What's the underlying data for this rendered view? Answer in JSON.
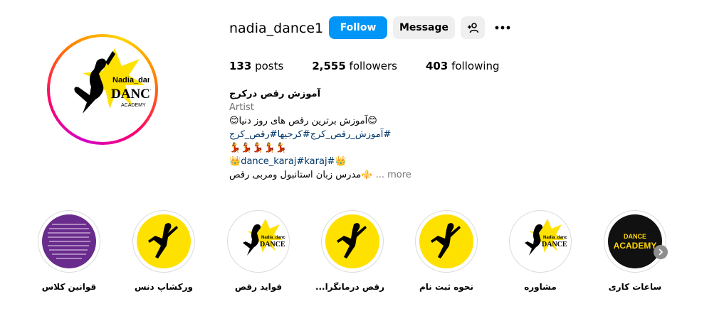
{
  "profile": {
    "username": "nadia_dance1",
    "follow_label": "Follow",
    "message_label": "Message",
    "logo_text": {
      "line1": "Nadia_dance",
      "line2": "DANCE",
      "line3": "ACADEMY"
    }
  },
  "stats": {
    "posts_count": "133",
    "posts_label": "posts",
    "followers_count": "2,555",
    "followers_label": "followers",
    "following_count": "403",
    "following_label": "following"
  },
  "bio": {
    "name": "آموزش رقص درکرج",
    "category": "Artist",
    "line1": "😊آموزش برترین رقص های روز دنیا😊",
    "line2": "#آموزش_رقص_کرج#کرجیها#رقص_کرج",
    "line3": "💃💃💃💃💃",
    "line4_prefix": "👑",
    "line4_link": "dance_karaj#karaj#",
    "line4_suffix": "👑",
    "line5_text": "⚜️مدرس زبان استانبول ومربی رقص",
    "line5_more": "... more"
  },
  "highlights": [
    {
      "label": "قوانین کلاس",
      "kind": "purple-text"
    },
    {
      "label": "ورکشاپ دنس",
      "kind": "yellow-dancer"
    },
    {
      "label": "فواید رقص",
      "kind": "logo"
    },
    {
      "label": "رقص درمانگرا...",
      "kind": "yellow-dancer"
    },
    {
      "label": "نحوه ثبت نام",
      "kind": "yellow-dancer"
    },
    {
      "label": "مشاوره",
      "kind": "logo"
    },
    {
      "label": "ساعات کاری",
      "kind": "dance-academy"
    }
  ],
  "highlight_art": {
    "dance_academy_line1": "DANCE",
    "dance_academy_line2": "ACADEMY"
  },
  "colors": {
    "follow_button": "#0095f6",
    "link": "#00376b",
    "secondary_text": "#737373",
    "yellow": "#ffe100"
  }
}
